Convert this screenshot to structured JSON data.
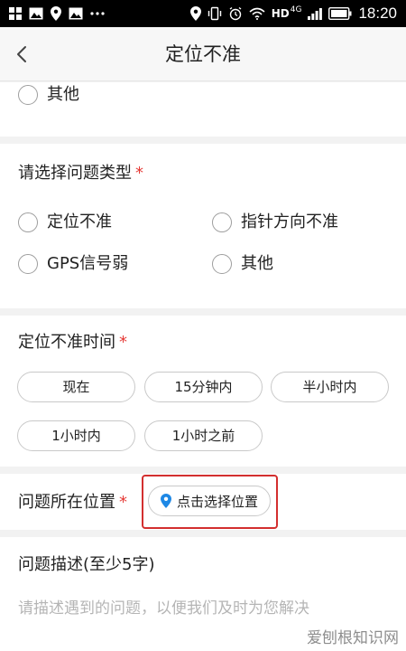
{
  "status_bar": {
    "hd_label": "HD",
    "network_type": "4G",
    "time": "18:20"
  },
  "nav": {
    "title": "定位不准"
  },
  "top_option": {
    "label": "其他"
  },
  "problem_type": {
    "title": "请选择问题类型",
    "required_mark": "*",
    "options": [
      "定位不准",
      "指针方向不准",
      "GPS信号弱",
      "其他"
    ]
  },
  "time_section": {
    "title": "定位不准时间",
    "required_mark": "*",
    "options": [
      "现在",
      "15分钟内",
      "半小时内",
      "1小时内",
      "1小时之前"
    ]
  },
  "location_section": {
    "title": "问题所在位置",
    "required_mark": "*",
    "button_label": "点击选择位置"
  },
  "description": {
    "title": "问题描述(至少5字)",
    "placeholder": "请描述遇到的问题，以便我们及时为您解决"
  },
  "watermark": "爱刨根知识网",
  "colors": {
    "required": "#e53935",
    "highlight_border": "#d32f2f",
    "location_pin": "#1e88e5"
  }
}
